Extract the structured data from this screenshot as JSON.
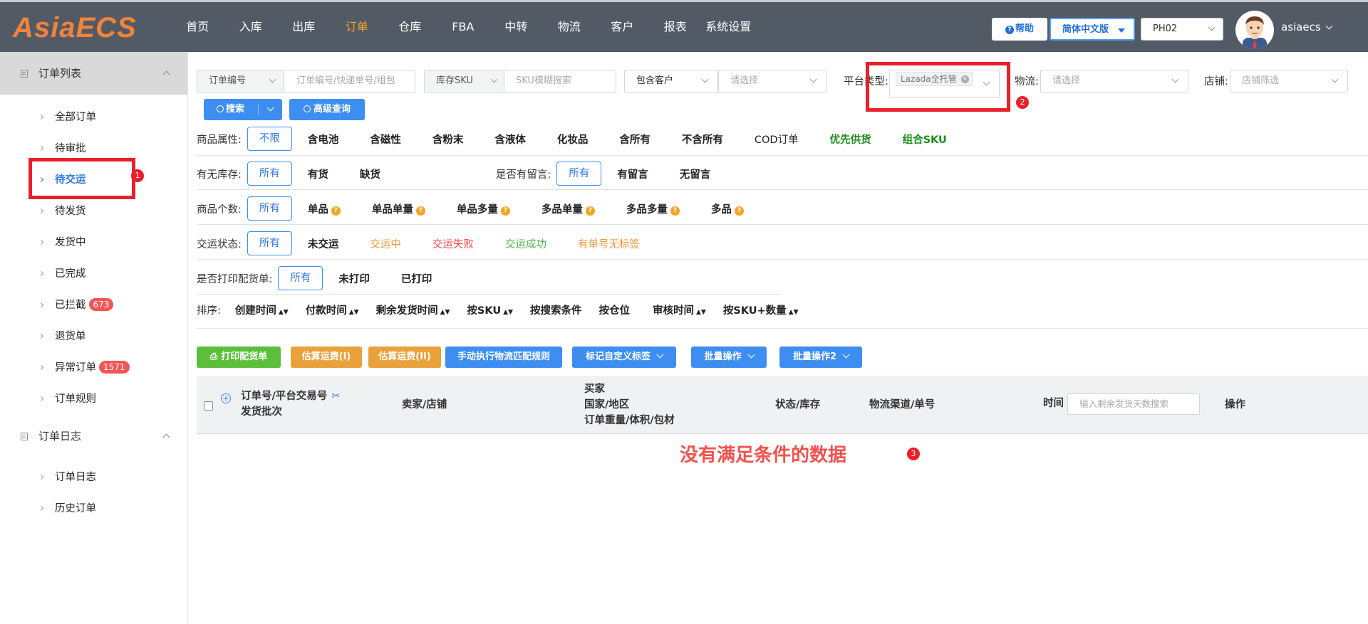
{
  "topbar": {
    "logo": "AsiaECS",
    "nav": [
      "首页",
      "入库",
      "出库",
      "订单",
      "仓库",
      "FBA",
      "中转",
      "物流",
      "客户",
      "报表",
      "系统设置"
    ],
    "active_nav": "订单",
    "help": "帮助",
    "language": "简体中文版",
    "warehouse": "PH02",
    "username": "asiaecs"
  },
  "sidebar": {
    "group1": "订单列表",
    "items1": [
      {
        "label": "全部订单"
      },
      {
        "label": "待审批"
      },
      {
        "label": "待交运"
      },
      {
        "label": "待发货"
      },
      {
        "label": "发货中"
      },
      {
        "label": "已完成"
      },
      {
        "label": "已拦截",
        "badge": "673"
      },
      {
        "label": "退货单"
      },
      {
        "label": "异常订单",
        "badge": "1571"
      },
      {
        "label": "订单规则"
      }
    ],
    "group2": "订单日志",
    "items2": [
      {
        "label": "订单日志"
      },
      {
        "label": "历史订单"
      }
    ]
  },
  "annotations": {
    "m1": "1",
    "m2": "2",
    "m3": "3"
  },
  "search": {
    "order_type": "订单编号",
    "order_placeholder": "订单编号/快递单号/组包",
    "sku_type": "库存SKU",
    "sku_placeholder": "SKU模糊搜索",
    "customer_mode": "包含客户",
    "customer_placeholder": "请选择",
    "platform_label": "平台类型:",
    "platform_tag": "Lazada全托管",
    "logistics_label": "物流:",
    "logistics_placeholder": "请选择",
    "store_label": "店铺:",
    "store_placeholder": "店铺筛选",
    "search_btn": "搜索",
    "advanced_btn": "高级查询"
  },
  "filters": {
    "attr_label": "商品属性:",
    "attr_options": [
      "不限",
      "含电池",
      "含磁性",
      "含粉末",
      "含液体",
      "化妆品",
      "含所有",
      "不含所有",
      "COD订单",
      "优先供货",
      "组合SKU"
    ],
    "stock_label": "有无库存:",
    "stock_options": [
      "所有",
      "有货",
      "缺货"
    ],
    "msg_label": "是否有留言:",
    "msg_options": [
      "所有",
      "有留言",
      "无留言"
    ],
    "count_label": "商品个数:",
    "count_options": [
      "所有",
      "单品",
      "单品单量",
      "单品多量",
      "多品单量",
      "多品多量",
      "多品"
    ],
    "ship_label": "交运状态:",
    "ship_options": [
      "所有",
      "未交运",
      "交运中",
      "交运失败",
      "交运成功",
      "有单号无标签"
    ],
    "print_label": "是否打印配货单:",
    "print_options": [
      "所有",
      "未打印",
      "已打印"
    ]
  },
  "sort": {
    "label": "排序:",
    "items": [
      "创建时间",
      "付款时间",
      "剩余发货时间",
      "按SKU",
      "按搜索条件",
      "按仓位",
      "审核时间",
      "按SKU+数量"
    ]
  },
  "actions": {
    "print": "打印配货单",
    "est1": "估算运费(I)",
    "est2": "估算运费(II)",
    "manual_rule": "手动执行物流匹配规则",
    "mark_tag": "标记自定义标签",
    "batch1": "批量操作",
    "batch2": "批量操作2"
  },
  "table": {
    "col_order_1": "订单号/平台交易号",
    "col_order_2": "发货批次",
    "col_seller": "卖家/店铺",
    "col_buyer_1": "买家",
    "col_buyer_2": "国家/地区",
    "col_buyer_3": "订单重量/体积/包材",
    "col_status": "状态/库存",
    "col_logistics": "物流渠道/单号",
    "col_time": "时间",
    "time_placeholder": "输入剩余发货天数搜索",
    "col_ops": "操作",
    "empty": "没有满足条件的数据"
  },
  "colors": {
    "accent": "#3d8ef0",
    "topbar": "#525a66",
    "logo": "#f2833a",
    "active_nav": "#f5a623",
    "annotation": "#e8202a"
  }
}
